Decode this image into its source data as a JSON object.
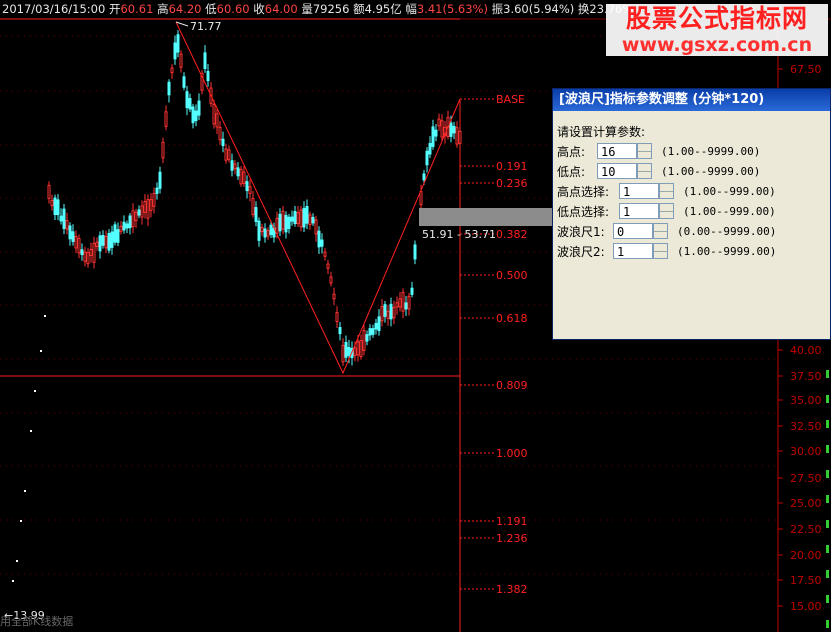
{
  "header": {
    "datetime": "2017/03/16/15:00",
    "open_label": "开",
    "open": "60.61",
    "high_label": "高",
    "high": "64.20",
    "low_label": "低",
    "low": "60.60",
    "close_label": "收",
    "close": "64.00",
    "volume_label": "量",
    "volume": "79256",
    "amount_label": "额",
    "amount": "4.95亿",
    "change_label": "幅",
    "change": "3.41(5.63%)",
    "amplitude_label": "振",
    "amplitude": "3.60(5.94%)",
    "turnover_label": "换",
    "turnover": "23.76%"
  },
  "watermark": {
    "line1": "股票公式指标网",
    "line2": "www.gsxz.com.cn"
  },
  "chart": {
    "peak_label": "71.77",
    "low_marker_label": "←13.99",
    "range_label": "51.91 - 53.71",
    "footer_text": "用全部K线数据",
    "right_prices": [
      "67.50",
      "40.00",
      "37.50",
      "35.00",
      "32.50",
      "30.00",
      "27.50",
      "25.00",
      "22.50",
      "20.00",
      "17.50",
      "15.00"
    ],
    "wave_levels": [
      {
        "label": "BASE"
      },
      {
        "label": "0.191"
      },
      {
        "label": "0.236"
      },
      {
        "label": "0.382"
      },
      {
        "label": "0.500"
      },
      {
        "label": "0.618"
      },
      {
        "label": "0.809"
      },
      {
        "label": "1.000"
      },
      {
        "label": "1.191"
      },
      {
        "label": "1.236"
      },
      {
        "label": "1.382"
      }
    ],
    "colors": {
      "up": "#ff3232",
      "down": "#54ffff",
      "level": "#ff2020",
      "axis": "#c00000"
    }
  },
  "dialog": {
    "title": "[波浪尺]指标参数调整 (分钟*120)",
    "prompt": "请设置计算参数:",
    "params": [
      {
        "label": "高点:",
        "value": "16",
        "range": "(1.00--9999.00)"
      },
      {
        "label": "低点:",
        "value": "10",
        "range": "(1.00--9999.00)"
      },
      {
        "label": "高点选择:",
        "value": "1",
        "range": "(1.00--999.00)"
      },
      {
        "label": "低点选择:",
        "value": "1",
        "range": "(1.00--999.00)"
      },
      {
        "label": "波浪尺1:",
        "value": "0",
        "range": "(0.00--9999.00)"
      },
      {
        "label": "波浪尺2:",
        "value": "1",
        "range": "(1.00--9999.00)"
      }
    ]
  }
}
